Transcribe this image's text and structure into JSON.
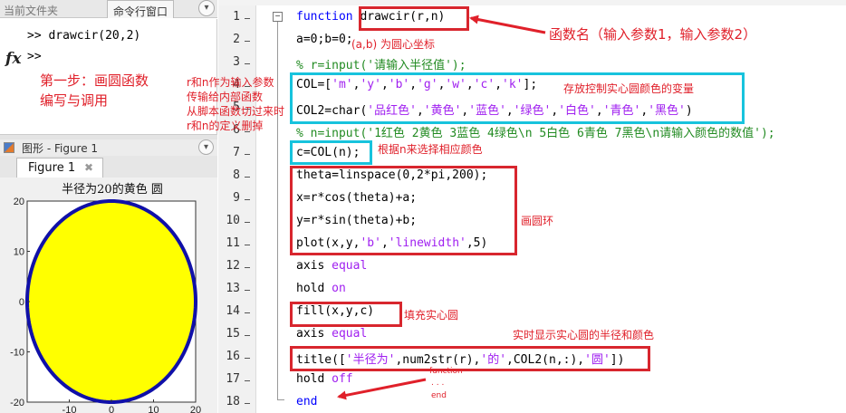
{
  "left_panel": {
    "tab_files": "当前文件夹",
    "tab_cmd": "命令行窗口",
    "cmd_lines": [
      ">> drawcir(20,2)",
      ">>"
    ],
    "fx": "fx",
    "note_step1_line1": "第一步：画圆函数",
    "note_step1_line2": "编写与调用"
  },
  "figure_window": {
    "title": "图形 - Figure 1",
    "tab_label": "Figure 1",
    "close_glyph": "✖"
  },
  "chart_data": {
    "type": "line",
    "title": "半径为20的黄色 圆",
    "xlim": [
      -20,
      20
    ],
    "ylim": [
      -20,
      20
    ],
    "xticks": [
      -10,
      0,
      10,
      20
    ],
    "yticks": [
      -20,
      -10,
      0,
      10,
      20
    ],
    "xtick_labels": [
      "-10",
      "0",
      "10",
      "20"
    ],
    "ytick_labels": [
      "-20",
      "-10",
      "0",
      "10",
      "20"
    ],
    "circle": {
      "center": [
        0,
        0
      ],
      "radius": 20
    },
    "line_color": "#0000ff",
    "fill_color": "#ffff00",
    "grid": false
  },
  "editor": {
    "line_numbers": [
      "1",
      "2",
      "3",
      "4",
      "5",
      "6",
      "7",
      "8",
      "9",
      "10",
      "11",
      "12",
      "13",
      "14",
      "15",
      "16",
      "17",
      "18"
    ],
    "lines": [
      [
        [
          "function ",
          "kw"
        ],
        [
          "drawcir(r,n)",
          ""
        ]
      ],
      [
        [
          "a=0;b=0;",
          ""
        ]
      ],
      [
        [
          "% r=input('请输入半径值');",
          "cm"
        ]
      ],
      [
        [
          "COL=[",
          ""
        ],
        [
          "'m'",
          "str"
        ],
        [
          ",",
          ""
        ],
        [
          "'y'",
          "str"
        ],
        [
          ",",
          ""
        ],
        [
          "'b'",
          "str"
        ],
        [
          ",",
          ""
        ],
        [
          "'g'",
          "str"
        ],
        [
          ",",
          ""
        ],
        [
          "'w'",
          "str"
        ],
        [
          ",",
          ""
        ],
        [
          "'c'",
          "str"
        ],
        [
          ",",
          ""
        ],
        [
          "'k'",
          "str"
        ],
        [
          "];",
          ""
        ]
      ],
      [
        [
          "COL2=char(",
          ""
        ],
        [
          "'品红色'",
          "str"
        ],
        [
          ",",
          ""
        ],
        [
          "'黄色'",
          "str"
        ],
        [
          ",",
          ""
        ],
        [
          "'蓝色'",
          "str"
        ],
        [
          ",",
          ""
        ],
        [
          "'绿色'",
          "str"
        ],
        [
          ",",
          ""
        ],
        [
          "'白色'",
          "str"
        ],
        [
          ",",
          ""
        ],
        [
          "'青色'",
          "str"
        ],
        [
          ",",
          ""
        ],
        [
          "'黑色'",
          "str"
        ],
        [
          ")",
          ""
        ]
      ],
      [
        [
          "% n=input('1红色 2黄色 3蓝色 4绿色\\n 5白色 6青色 7黑色\\n请输入颜色的数值');",
          "cm"
        ]
      ],
      [
        [
          "c=COL(n);",
          ""
        ]
      ],
      [
        [
          "theta=linspace(0,2*pi,200);",
          ""
        ]
      ],
      [
        [
          "x=r*cos(theta)+a;",
          ""
        ]
      ],
      [
        [
          "y=r*sin(theta)+b;",
          ""
        ]
      ],
      [
        [
          "plot(x,y,",
          ""
        ],
        [
          "'b'",
          "str"
        ],
        [
          ",",
          ""
        ],
        [
          "'linewidth'",
          "str"
        ],
        [
          ",5)",
          ""
        ]
      ],
      [
        [
          "axis ",
          ""
        ],
        [
          "equal",
          "str"
        ]
      ],
      [
        [
          "hold ",
          ""
        ],
        [
          "on",
          "str"
        ]
      ],
      [
        [
          "fill(x,y,c)",
          ""
        ]
      ],
      [
        [
          "axis ",
          ""
        ],
        [
          "equal",
          "str"
        ]
      ],
      [
        [
          "title([",
          ""
        ],
        [
          "'半径为'",
          "str"
        ],
        [
          ",num2str(r),",
          ""
        ],
        [
          "'的'",
          "str"
        ],
        [
          ",COL2(n,:),",
          ""
        ],
        [
          "'圆'",
          "str"
        ],
        [
          "])",
          ""
        ]
      ],
      [
        [
          "hold ",
          ""
        ],
        [
          "off",
          "str"
        ]
      ],
      [
        [
          "end",
          "kw"
        ]
      ]
    ]
  },
  "annotations": {
    "func_name": "函数名（输入参数1，输入参数2）",
    "center": "(a,b) 为圆心坐标",
    "rn_1": "r和n作为输入参数",
    "rn_2": "传输给内部函数",
    "rn_3": "从脚本函数切过来时",
    "rn_4": "r和n的定义删掉",
    "color_var": "存放控制实心圆颜色的变量",
    "choose_color": "根据n来选择相应颜色",
    "ring": "画圆环",
    "fill": "填充实心圆",
    "title_note": "实时显示实心圆的半径和颜色",
    "function_end_1": "function",
    "function_end_2": ". . .",
    "function_end_3": "end"
  },
  "colors": {
    "annotation_red": "#e0202a",
    "box_red": "#d8262e",
    "box_cyan": "#17c3dd"
  }
}
